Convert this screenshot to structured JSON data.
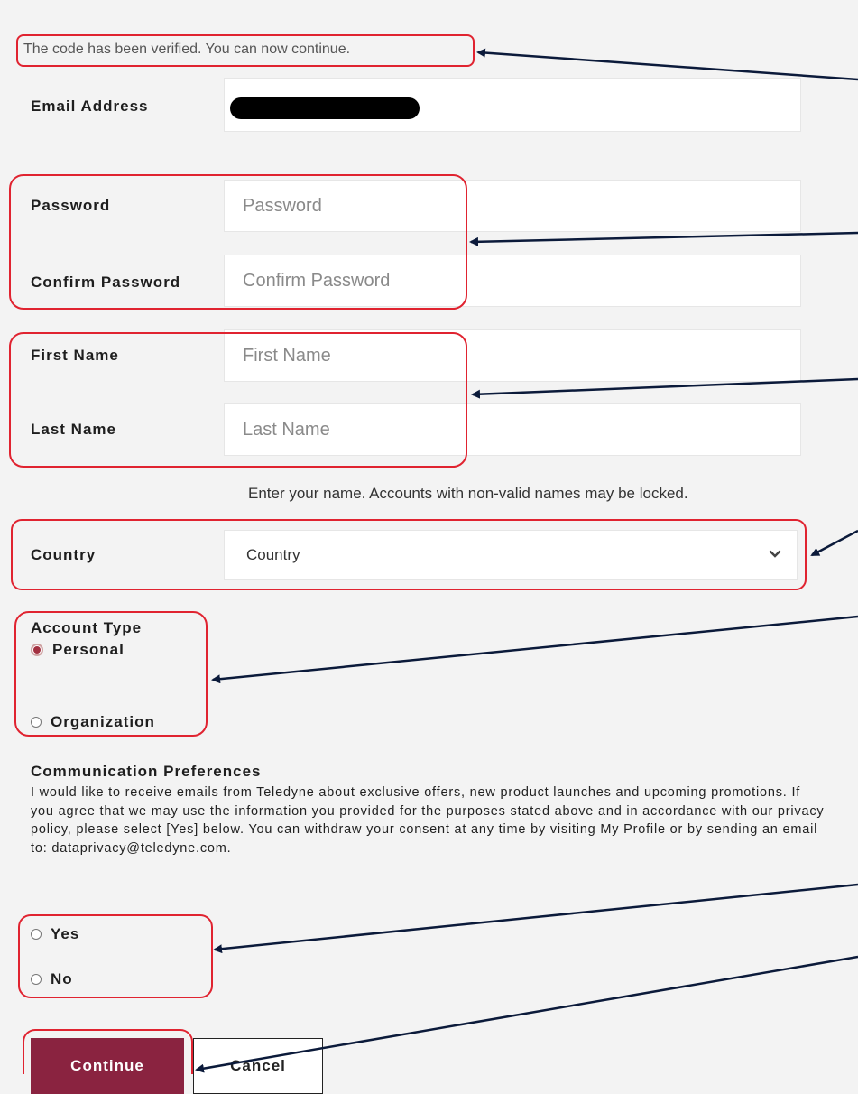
{
  "status": {
    "verified_message": "The code has been verified. You can now continue."
  },
  "fields": {
    "email": {
      "label": "Email Address"
    },
    "password": {
      "label": "Password",
      "placeholder": "Password"
    },
    "confirm_password": {
      "label": "Confirm Password",
      "placeholder": "Confirm Password"
    },
    "first_name": {
      "label": "First Name",
      "placeholder": "First Name"
    },
    "last_name": {
      "label": "Last Name",
      "placeholder": "Last Name"
    },
    "name_hint": "Enter your name. Accounts with non-valid names may be locked.",
    "country": {
      "label": "Country",
      "selected": "Country"
    }
  },
  "account_type": {
    "title": "Account Type",
    "options": [
      {
        "label": "Personal",
        "checked": true
      },
      {
        "label": "Organization",
        "checked": false
      }
    ]
  },
  "communication": {
    "title": "Communication Preferences",
    "text": "I would like to receive emails from Teledyne about exclusive offers, new product launches and upcoming promotions. If you agree that we may use the information you provided for the purposes stated above and in accordance with our privacy policy, please select [Yes] below. You can withdraw your consent at any time by visiting My Profile or by sending an email to: dataprivacy@teledyne.com.",
    "options": [
      {
        "label": "Yes",
        "checked": false
      },
      {
        "label": "No",
        "checked": false
      }
    ]
  },
  "buttons": {
    "continue": "Continue",
    "cancel": "Cancel"
  },
  "colors": {
    "primary": "#8a2340",
    "annotation_box": "#e02330",
    "annotation_arrow": "#0b1a3a"
  }
}
